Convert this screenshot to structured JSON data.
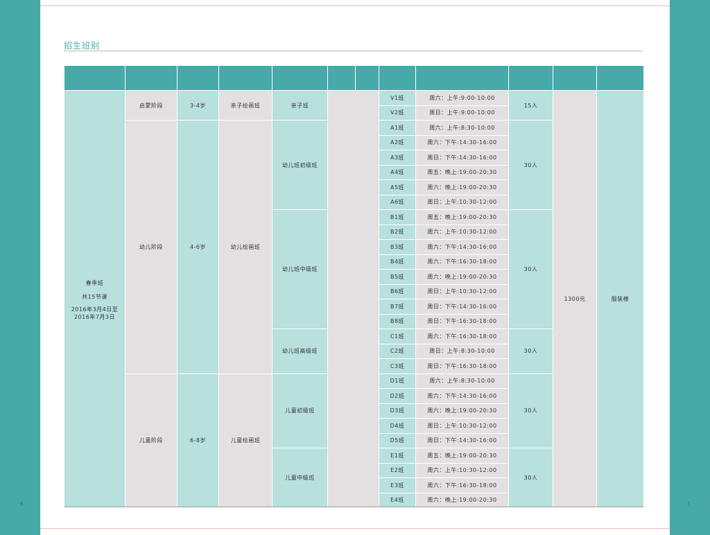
{
  "page": {
    "section_title": "招生班别",
    "left_page_number": "6",
    "right_page_number": "7"
  },
  "season": {
    "name": "春季班",
    "lessons": "共15节课",
    "period": "2016年3月4日至2016年7月3日"
  },
  "fee": "1300元",
  "location": "服装楼",
  "stages": [
    {
      "name": "启蒙阶段",
      "age": "3-4岁",
      "course": "亲子绘画班"
    },
    {
      "name": "幼儿阶段",
      "age": "4-6岁",
      "course": "幼儿绘画班"
    },
    {
      "name": "儿童阶段",
      "age": "6-8岁",
      "course": "儿童绘画班"
    }
  ],
  "levels": [
    {
      "name": "亲子班",
      "capacity": "15人"
    },
    {
      "name": "幼儿班初级班",
      "capacity": "30人"
    },
    {
      "name": "幼儿班中级班",
      "capacity": "30人"
    },
    {
      "name": "幼儿班高级班",
      "capacity": "30人"
    },
    {
      "name": "儿童初级班",
      "capacity": "30人"
    },
    {
      "name": "儿童中级班",
      "capacity": "30人"
    }
  ],
  "rows": [
    {
      "cls": "V1班",
      "time": "周六：上午:9:00-10:00"
    },
    {
      "cls": "V2班",
      "time": "周日：上午:9:00-10:00"
    },
    {
      "cls": "A1班",
      "time": "周六：上午:8:30-10:00"
    },
    {
      "cls": "A2班",
      "time": "周六：下午:14:30-16:00"
    },
    {
      "cls": "A3班",
      "time": "周日：下午:14:30-16:00"
    },
    {
      "cls": "A4班",
      "time": "周五：晚上:19:00-20:30"
    },
    {
      "cls": "A5班",
      "time": "周六：晚上:19:00-20:30"
    },
    {
      "cls": "A6班",
      "time": "周日：上午:10:30-12:00"
    },
    {
      "cls": "B1班",
      "time": "周五：晚上:19:00-20:30"
    },
    {
      "cls": "B2班",
      "time": "周六：上午:10:30-12:00"
    },
    {
      "cls": "B3班",
      "time": "周六：下午:14:30-16:00"
    },
    {
      "cls": "B4班",
      "time": "周六：下午:16:30-18:00"
    },
    {
      "cls": "B5班",
      "time": "周六：晚上:19:00-20:30"
    },
    {
      "cls": "B6班",
      "time": "周日：上午:10:30-12:00"
    },
    {
      "cls": "B7班",
      "time": "周日：下午:14:30-16:00"
    },
    {
      "cls": "B8班",
      "time": "周日：下午:16:30-18:00"
    },
    {
      "cls": "C1班",
      "time": "周六：下午:16:30-18:00"
    },
    {
      "cls": "C2班",
      "time": "周日：上午:8:30-10:00"
    },
    {
      "cls": "C3班",
      "time": "周日：下午:16:30-18:00"
    },
    {
      "cls": "D1班",
      "time": "周六：上午:8:30-10:00"
    },
    {
      "cls": "D2班",
      "time": "周六：下午:14:30-16:00"
    },
    {
      "cls": "D3班",
      "time": "周六：晚上:19:00-20:30"
    },
    {
      "cls": "D4班",
      "time": "周日：上午:10:30-12:00"
    },
    {
      "cls": "D5班",
      "time": "周日：下午:14:30-16:00"
    },
    {
      "cls": "E1班",
      "time": "周五：晚上:19:00-20:30"
    },
    {
      "cls": "E2班",
      "time": "周六：上午:10:30-12:00"
    },
    {
      "cls": "E3班",
      "time": "周六：下午:16:30-18:00"
    },
    {
      "cls": "E4班",
      "time": "周六：晚上:19:00-20:30"
    }
  ]
}
